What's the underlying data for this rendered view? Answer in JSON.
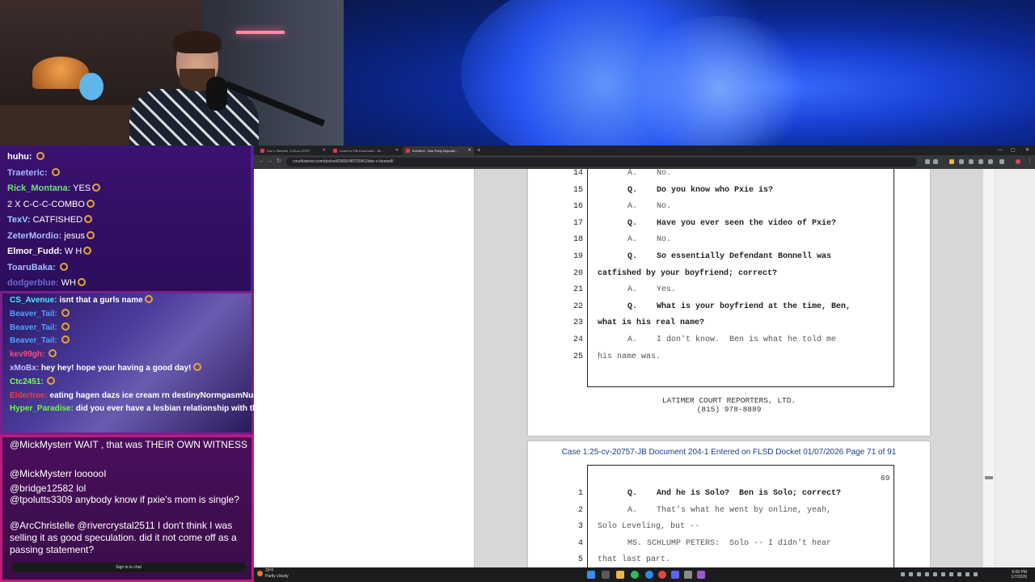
{
  "chat": {
    "top_messages": [
      {
        "user": "huhu:",
        "user_color": "#ffffff",
        "text": ""
      },
      {
        "user": "Traeteric:",
        "user_color": "#9fb6ff",
        "text": ""
      },
      {
        "user": "Rick_Montana:",
        "user_color": "#6ee07a",
        "text": "YES"
      },
      {
        "user": "",
        "user_color": "#ffffff",
        "text": "2 X  C-C-C-COMBO"
      },
      {
        "user": "TexV:",
        "user_color": "#9fd0ff",
        "text": "CATFISHED"
      },
      {
        "user": "ZeterMordio:",
        "user_color": "#a8c0ff",
        "text": "jesus"
      },
      {
        "user": "Elmor_Fudd:",
        "user_color": "#ffffff",
        "text": "W H"
      },
      {
        "user": "ToaruBaka:",
        "user_color": "#a8c0ff",
        "text": ""
      },
      {
        "user": "dodgerblue:",
        "user_color": "#6a6ad0",
        "text": "WH"
      }
    ],
    "mid_messages": [
      {
        "user": "CS_Avenue:",
        "user_color": "#58e5ff",
        "text": "isnt that a gurls name"
      },
      {
        "user": "Beaver_Tail:",
        "user_color": "#4fa0ff",
        "text": ""
      },
      {
        "user": "Beaver_Tail:",
        "user_color": "#4fa0ff",
        "text": ""
      },
      {
        "user": "Beaver_Tail:",
        "user_color": "#4fa0ff",
        "text": ""
      },
      {
        "user": "kev99gh:",
        "user_color": "#ff4a7a",
        "text": ""
      },
      {
        "user": "xMoBx:",
        "user_color": "#c8c0ff",
        "text": "hey hey! hope your having a good day!"
      },
      {
        "user": "Ctc2451:",
        "user_color": "#7aff6a",
        "text": ""
      },
      {
        "user": "Eldertree:",
        "user_color": "#ff3a3a",
        "text": "eating hagen dazs ice cream rn destinyNormgasmNugTime"
      },
      {
        "user": "Hyper_Paradise:",
        "user_color": "#6aff3a",
        "text": "did you ever have a lesbian relationship with this destiny woman?"
      }
    ],
    "bottom_messages": [
      {
        "text": "@MickMysterr WAIT , that was THEIR OWN WITNESS"
      },
      {
        "text": "@MickMysterr loooooI"
      },
      {
        "text": "@bridge12582 lol"
      },
      {
        "text": "@tpolutts3309 anybody know if pxie's mom is single?"
      },
      {
        "text": "@ArcChristelle @rivercrystal2511 I don't think I was selling it as good speculation. did it not come off as a passing statement?"
      }
    ],
    "sign_in": "Sign in to chat"
  },
  "browser": {
    "tabs": [
      {
        "label": "Doe v. Bonnell, 1:25-cv-20757"
      },
      {
        "label": "Leave to File Document – #2…"
      },
      {
        "label": "Exhibit A - Non-Party Depositi…"
      }
    ],
    "url": "courtlistener.com/docket/69650487/204/1/doe-v-bonnell/"
  },
  "document": {
    "page1_lines": [
      {
        "num": "14",
        "kind": "a",
        "text": "A.    No."
      },
      {
        "num": "15",
        "kind": "q",
        "text": "Q.    Do you know who Pxie is?"
      },
      {
        "num": "16",
        "kind": "a",
        "text": "A.    No."
      },
      {
        "num": "17",
        "kind": "q",
        "text": "Q.    Have you ever seen the video of Pxie?"
      },
      {
        "num": "18",
        "kind": "a",
        "text": "A.    No."
      },
      {
        "num": "19",
        "kind": "q",
        "text": "Q.    So essentially Defendant Bonnell was"
      },
      {
        "num": "20",
        "kind": "qc",
        "text": "catfished by your boyfriend; correct?"
      },
      {
        "num": "21",
        "kind": "a",
        "text": "A.    Yes."
      },
      {
        "num": "22",
        "kind": "q",
        "text": "Q.    What is your boyfriend at the time, Ben,"
      },
      {
        "num": "23",
        "kind": "qc",
        "text": "what is his real name?"
      },
      {
        "num": "24",
        "kind": "a",
        "text": "A.    I don't know.  Ben is what he told me"
      },
      {
        "num": "25",
        "kind": "ac",
        "text": "his name was."
      }
    ],
    "footer_line1": "LATIMER COURT REPORTERS, LTD.",
    "footer_line2": "(815) 978-8889",
    "page2_header": "Case 1:25-cv-20757-JB   Document 204-1   Entered on FLSD Docket 01/07/2026   Page 71 of 91",
    "page2_number": "69",
    "page2_lines": [
      {
        "num": "1",
        "kind": "q",
        "text": "Q.    And he is Solo?  Ben is Solo; correct?"
      },
      {
        "num": "2",
        "kind": "a",
        "text": "A.    That's what he went by online, yeah,"
      },
      {
        "num": "3",
        "kind": "ac",
        "text": "Solo Leveling, but --"
      },
      {
        "num": "4",
        "kind": "a",
        "text": "MS. SCHLUMP PETERS:  Solo -- I didn't hear"
      },
      {
        "num": "5",
        "kind": "ac",
        "text": "that last part."
      }
    ]
  },
  "taskbar": {
    "weather_temp": "29°F",
    "weather_desc": "Partly cloudy",
    "time": "6:06 PM",
    "date": "1/7/2026"
  }
}
